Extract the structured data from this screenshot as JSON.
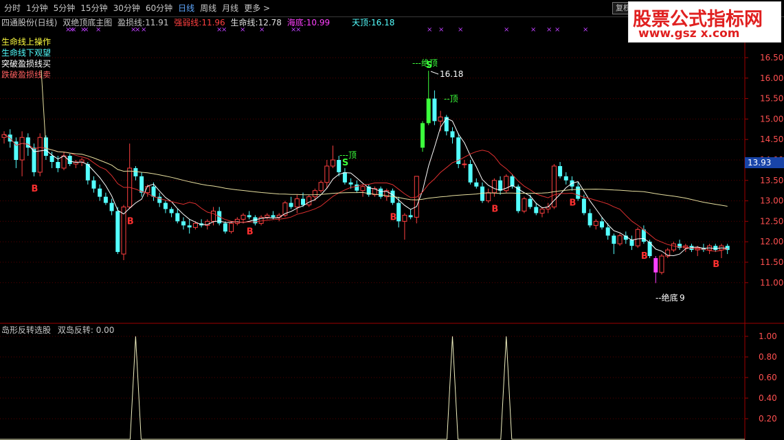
{
  "toolbar": {
    "tabs": [
      "分时",
      "1分钟",
      "5分钟",
      "15分钟",
      "30分钟",
      "60分钟",
      "日线",
      "周线",
      "月线",
      "更多 >"
    ],
    "active_tab": "日线",
    "fq_label": "复权"
  },
  "brand": {
    "title": "股票公式指标网",
    "url": "www.gsz x.com"
  },
  "info": {
    "stock": "四通股份(日线)",
    "indicator": "双绝顶底主图",
    "yk_label": "盈损线:",
    "yk_value": "11.91",
    "qr_label": "强弱线:",
    "qr_value": "11.96",
    "sm_label": "生命线:",
    "sm_value": "12.78",
    "hd_label": "海底:",
    "hd_value": "10.99",
    "td_label": "天顶:",
    "td_value": "16.18"
  },
  "legend": [
    "生命线上操作",
    "生命线下观望",
    "突破盈损线买",
    "跌破盈损线卖"
  ],
  "colors": {
    "up": "#ff4040",
    "down": "#54ffff",
    "accent": "#5fa8ff",
    "green": "#3cff3c",
    "magenta": "#ff40ff",
    "gold": "#e8e0a0",
    "axis": "#a00000"
  },
  "price_axis": {
    "ticks": [
      16.5,
      16.0,
      15.5,
      15.0,
      14.5,
      14.0,
      13.5,
      13.0,
      12.5,
      12.0,
      11.5,
      11.0
    ],
    "current": "13.93"
  },
  "sub_axis": {
    "ticks": [
      "1.00",
      "0.80",
      "0.60",
      "0.40",
      "0.20"
    ]
  },
  "sub_info": {
    "name": "岛形反转选股",
    "label": "双岛反转:",
    "value": "0.00"
  },
  "annotations": {
    "top_max": "16.18",
    "top_label": "---绝顶",
    "top_s": "S",
    "top_s2": "--顶",
    "mid_top": "---顶",
    "bottom_label": "--绝底",
    "bottom_value": "9",
    "buy": "B",
    "sell": "S"
  },
  "chart_data": {
    "type": "candlestick",
    "series_name": "四通股份(日线)",
    "candles": [
      [
        14.55,
        14.7,
        14.4,
        14.62
      ],
      [
        14.62,
        14.75,
        14.3,
        14.45
      ],
      [
        14.45,
        14.55,
        13.8,
        14.0
      ],
      [
        14.0,
        14.7,
        13.6,
        14.55
      ],
      [
        14.55,
        14.65,
        14.1,
        14.3
      ],
      [
        14.3,
        14.4,
        13.6,
        13.7
      ],
      [
        13.7,
        14.65,
        13.6,
        14.55
      ],
      [
        14.55,
        14.6,
        14.0,
        14.1
      ],
      [
        14.1,
        14.2,
        13.8,
        13.95
      ],
      [
        13.95,
        14.1,
        13.7,
        13.8
      ],
      [
        13.8,
        14.2,
        13.75,
        14.1
      ],
      [
        14.1,
        14.15,
        13.85,
        13.9
      ],
      [
        13.9,
        14.0,
        13.8,
        13.95
      ],
      [
        13.95,
        14.05,
        13.85,
        14.0
      ],
      [
        13.9,
        13.95,
        13.4,
        13.5
      ],
      [
        13.5,
        13.6,
        13.2,
        13.3
      ],
      [
        13.3,
        13.4,
        13.0,
        13.1
      ],
      [
        13.1,
        13.2,
        12.9,
        12.95
      ],
      [
        12.95,
        13.05,
        12.65,
        12.75
      ],
      [
        12.75,
        12.85,
        11.7,
        11.75
      ],
      [
        11.7,
        12.9,
        11.55,
        12.85
      ],
      [
        12.85,
        14.4,
        12.8,
        13.8
      ],
      [
        13.8,
        13.85,
        13.5,
        13.6
      ],
      [
        13.6,
        13.7,
        13.1,
        13.2
      ],
      [
        13.2,
        13.4,
        13.1,
        13.35
      ],
      [
        13.35,
        13.45,
        13.0,
        13.1
      ],
      [
        13.1,
        13.2,
        12.85,
        12.95
      ],
      [
        12.95,
        13.0,
        12.7,
        12.8
      ],
      [
        12.8,
        12.85,
        12.6,
        12.7
      ],
      [
        12.7,
        12.8,
        12.45,
        12.5
      ],
      [
        12.5,
        12.6,
        12.3,
        12.4
      ],
      [
        12.4,
        12.55,
        12.2,
        12.35
      ],
      [
        12.35,
        12.5,
        12.3,
        12.45
      ],
      [
        12.45,
        12.55,
        12.35,
        12.4
      ],
      [
        12.4,
        12.55,
        12.3,
        12.5
      ],
      [
        12.5,
        12.85,
        12.4,
        12.75
      ],
      [
        12.75,
        12.85,
        12.4,
        12.45
      ],
      [
        12.45,
        12.5,
        12.2,
        12.25
      ],
      [
        12.25,
        12.5,
        12.2,
        12.45
      ],
      [
        12.45,
        12.6,
        12.4,
        12.55
      ],
      [
        12.55,
        12.7,
        12.45,
        12.65
      ],
      [
        12.65,
        12.75,
        12.55,
        12.6
      ],
      [
        12.6,
        12.65,
        12.4,
        12.45
      ],
      [
        12.45,
        12.65,
        12.4,
        12.6
      ],
      [
        12.6,
        12.7,
        12.55,
        12.65
      ],
      [
        12.65,
        12.75,
        12.55,
        12.6
      ],
      [
        12.6,
        12.7,
        12.5,
        12.65
      ],
      [
        12.65,
        13.0,
        12.6,
        12.95
      ],
      [
        12.95,
        13.1,
        12.8,
        12.85
      ],
      [
        12.85,
        13.15,
        12.7,
        13.05
      ],
      [
        13.05,
        13.2,
        12.85,
        12.9
      ],
      [
        12.9,
        13.15,
        12.85,
        13.1
      ],
      [
        13.1,
        13.3,
        13.0,
        13.25
      ],
      [
        13.25,
        13.5,
        13.2,
        13.45
      ],
      [
        13.45,
        14.0,
        13.3,
        13.85
      ],
      [
        13.85,
        14.35,
        13.8,
        14.0
      ],
      [
        14.0,
        14.1,
        13.6,
        13.7
      ],
      [
        13.7,
        13.8,
        13.4,
        13.45
      ],
      [
        13.45,
        13.55,
        13.3,
        13.4
      ],
      [
        13.4,
        13.5,
        13.2,
        13.25
      ],
      [
        13.25,
        13.4,
        13.1,
        13.35
      ],
      [
        13.35,
        13.4,
        13.1,
        13.15
      ],
      [
        13.15,
        13.35,
        13.1,
        13.3
      ],
      [
        13.3,
        13.35,
        13.05,
        13.1
      ],
      [
        13.1,
        13.3,
        13.0,
        13.25
      ],
      [
        13.25,
        13.3,
        12.9,
        12.95
      ],
      [
        12.95,
        13.1,
        12.35,
        12.5
      ],
      [
        12.5,
        12.7,
        12.05,
        12.65
      ],
      [
        12.65,
        12.8,
        12.55,
        12.6
      ],
      [
        12.6,
        13.6,
        12.45,
        13.6
      ],
      [
        14.3,
        14.95,
        14.2,
        14.9
      ],
      [
        14.9,
        16.18,
        14.85,
        15.5
      ],
      [
        15.5,
        15.7,
        14.85,
        14.95
      ],
      [
        14.95,
        15.2,
        14.7,
        15.05
      ],
      [
        15.05,
        15.1,
        14.6,
        14.7
      ],
      [
        14.7,
        14.8,
        14.4,
        14.55
      ],
      [
        14.55,
        14.65,
        13.8,
        13.9
      ],
      [
        13.9,
        14.0,
        13.8,
        13.9
      ],
      [
        13.9,
        14.0,
        13.4,
        13.45
      ],
      [
        13.45,
        13.55,
        13.3,
        13.35
      ],
      [
        13.35,
        13.45,
        12.95,
        13.0
      ],
      [
        13.0,
        13.3,
        12.95,
        13.2
      ],
      [
        13.2,
        13.55,
        13.1,
        13.5
      ],
      [
        13.5,
        13.6,
        13.15,
        13.25
      ],
      [
        13.25,
        13.65,
        13.2,
        13.6
      ],
      [
        13.6,
        13.65,
        13.3,
        13.35
      ],
      [
        13.35,
        13.4,
        12.7,
        12.75
      ],
      [
        12.75,
        13.1,
        12.7,
        13.05
      ],
      [
        13.05,
        13.15,
        12.8,
        12.85
      ],
      [
        12.85,
        12.95,
        12.65,
        12.7
      ],
      [
        12.7,
        12.85,
        12.6,
        12.8
      ],
      [
        12.8,
        12.95,
        12.7,
        12.85
      ],
      [
        12.85,
        13.9,
        12.8,
        13.85
      ],
      [
        13.85,
        13.95,
        13.55,
        13.6
      ],
      [
        13.6,
        13.7,
        13.4,
        13.5
      ],
      [
        13.5,
        13.6,
        13.25,
        13.35
      ],
      [
        13.35,
        13.45,
        13.0,
        13.05
      ],
      [
        13.05,
        13.15,
        12.65,
        12.7
      ],
      [
        12.7,
        12.8,
        12.35,
        12.4
      ],
      [
        12.4,
        12.55,
        12.3,
        12.5
      ],
      [
        12.5,
        12.6,
        12.3,
        12.35
      ],
      [
        12.35,
        12.45,
        12.05,
        12.15
      ],
      [
        12.15,
        12.2,
        11.7,
        11.95
      ],
      [
        11.95,
        12.2,
        11.9,
        12.15
      ],
      [
        12.15,
        12.25,
        11.95,
        12.05
      ],
      [
        12.05,
        12.15,
        11.8,
        11.9
      ],
      [
        11.9,
        12.35,
        11.85,
        12.3
      ],
      [
        12.3,
        12.4,
        11.95,
        12.0
      ],
      [
        12.0,
        12.05,
        11.6,
        11.65
      ],
      [
        11.6,
        11.65,
        10.99,
        11.25
      ],
      [
        11.25,
        11.7,
        11.2,
        11.65
      ],
      [
        11.65,
        11.85,
        11.6,
        11.8
      ],
      [
        11.8,
        12.0,
        11.75,
        11.95
      ],
      [
        11.95,
        12.05,
        11.8,
        11.85
      ],
      [
        11.85,
        11.95,
        11.75,
        11.9
      ],
      [
        11.9,
        11.95,
        11.75,
        11.8
      ],
      [
        11.8,
        11.9,
        11.65,
        11.85
      ],
      [
        11.85,
        11.95,
        11.75,
        11.8
      ],
      [
        11.8,
        11.95,
        11.7,
        11.9
      ],
      [
        11.9,
        11.95,
        11.75,
        11.8
      ],
      [
        11.8,
        11.95,
        11.6,
        11.9
      ],
      [
        11.9,
        11.95,
        11.7,
        11.8
      ]
    ],
    "buy_markers": [
      5,
      21,
      41,
      65,
      82,
      95,
      107,
      119
    ],
    "sell_markers": [
      57,
      71
    ],
    "island_signals": [
      22,
      75,
      84
    ]
  }
}
